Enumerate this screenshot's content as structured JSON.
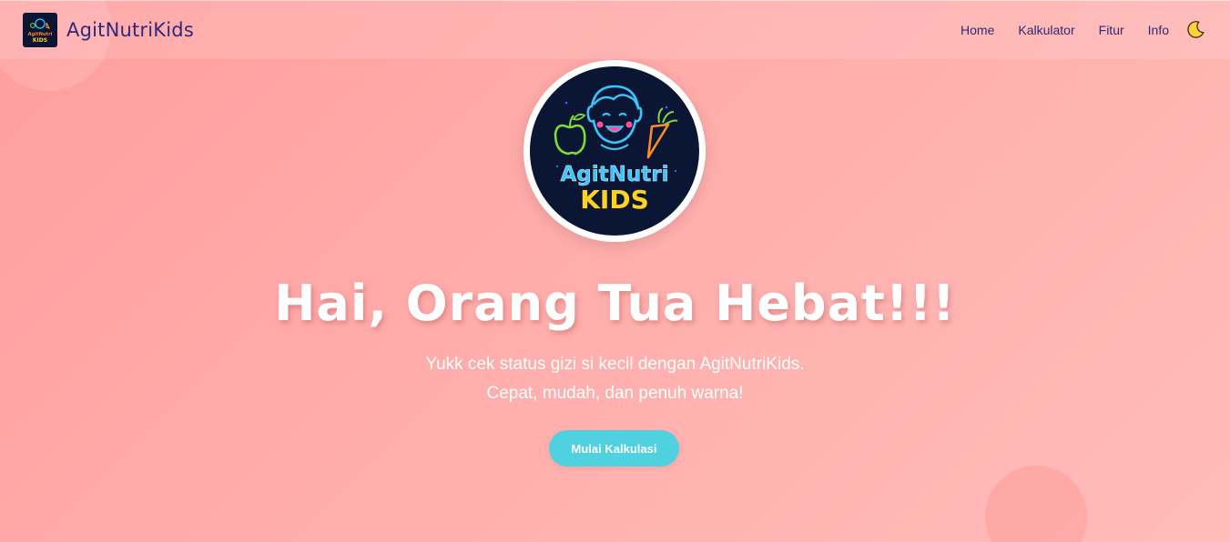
{
  "brand": {
    "title": "AgitNutriKids",
    "logo_text_top": "AgitNutri",
    "logo_text_bottom": "KIDS"
  },
  "nav": {
    "items": [
      {
        "label": "Home"
      },
      {
        "label": "Kalkulator"
      },
      {
        "label": "Fitur"
      },
      {
        "label": "Info"
      }
    ],
    "theme_icon": "moon-icon"
  },
  "hero": {
    "title": "Hai, Orang Tua Hebat!!!",
    "subtitle_line1": "Yukk cek status gizi si kecil dengan AgitNutriKids.",
    "subtitle_line2": "Cepat, mudah, dan penuh warna!",
    "cta_label": "Mulai Kalkulasi"
  },
  "colors": {
    "background": "#ffa3a3",
    "nav_text": "#2c2a7a",
    "cta": "#4fd1e0",
    "logo_bg": "#0b1634"
  }
}
